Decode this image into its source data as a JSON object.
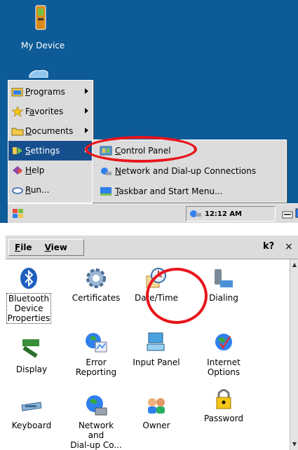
{
  "desktop": {
    "icon_label": "My Device"
  },
  "start_menu": {
    "items": [
      {
        "label": "Programs",
        "hotkey": "P",
        "rest": "rograms"
      },
      {
        "label": "Favorites",
        "hotkey": "a",
        "pre": "F",
        "rest": "vorites"
      },
      {
        "label": "Documents",
        "hotkey": "D",
        "rest": "ocuments"
      },
      {
        "label": "Settings",
        "hotkey": "S",
        "rest": "ettings"
      },
      {
        "label": "Help",
        "hotkey": "H",
        "rest": "elp"
      },
      {
        "label": "Run...",
        "hotkey": "R",
        "rest": "un..."
      }
    ]
  },
  "settings_submenu": {
    "items": [
      {
        "label": "Control Panel",
        "hotkey": "C",
        "rest": "ontrol Panel"
      },
      {
        "label": "Network and Dial-up Connections",
        "hotkey": "N",
        "rest": "etwork and Dial-up Connections"
      },
      {
        "label": "Taskbar and Start Menu...",
        "hotkey": "T",
        "rest": "askbar and Start Menu..."
      }
    ]
  },
  "taskbar": {
    "clock": "12:12 AM"
  },
  "control_panel": {
    "menus": [
      {
        "label": "File",
        "hotkey": "F",
        "rest": "ile"
      },
      {
        "label": "View",
        "hotkey": "V",
        "rest": "iew"
      }
    ],
    "help_label": "k?",
    "close_label": "×",
    "items": [
      {
        "l1": "Bluetooth",
        "l2": "Device",
        "l3": "Properties"
      },
      {
        "l1": "Certificates"
      },
      {
        "l1": "Date/Time"
      },
      {
        "l1": "Dialing"
      },
      {
        "l1": "Display"
      },
      {
        "l1": "Error",
        "l2": "Reporting"
      },
      {
        "l1": "Input Panel"
      },
      {
        "l1": "Internet",
        "l2": "Options"
      },
      {
        "l1": "Keyboard"
      },
      {
        "l1": "Network and",
        "l2": "Dial-up Co..."
      },
      {
        "l1": "Owner"
      },
      {
        "l1": "Password"
      }
    ]
  },
  "colors": {
    "desktop": "#0d5b97",
    "selection": "#174f8e",
    "highlight_ring": "#e8141b",
    "menu_bg": "#dcdcdc"
  }
}
